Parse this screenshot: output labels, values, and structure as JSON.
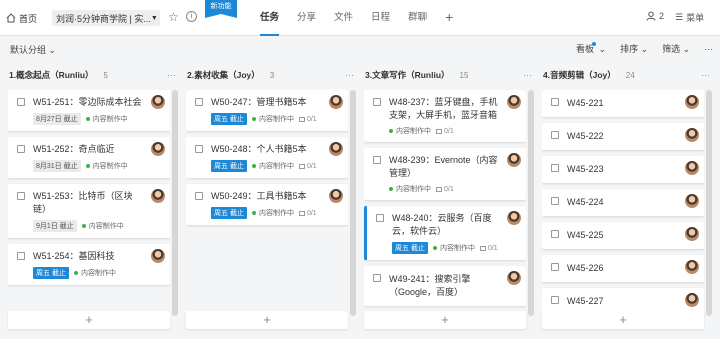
{
  "topbar": {
    "home_label": "首页",
    "project_label": "刘润·5分钟商学院 | 实...",
    "new_feature_badge": "新功能",
    "tabs": [
      "任务",
      "分享",
      "文件",
      "日程",
      "群聊"
    ],
    "active_tab": "任务",
    "members_count": "2",
    "menu_label": "菜单"
  },
  "toolbar": {
    "group_label": "默认分组",
    "board_label": "看板",
    "sort_label": "排序",
    "filter_label": "筛选"
  },
  "columns": [
    {
      "title": "1.概念起点（Runliu）",
      "count": "5",
      "cards": [
        {
          "title": "W51-251：零边际成本社会",
          "due": "8月27日 截止",
          "due_style": "gray",
          "status": "内容制作中"
        },
        {
          "title": "W51-252：奇点临近",
          "due": "8月31日 截止",
          "due_style": "gray",
          "status": "内容制作中"
        },
        {
          "title": "W51-253：比特币（区块链）",
          "due": "9月1日 截止",
          "due_style": "gray",
          "status": "内容制作中"
        },
        {
          "title": "W51-254：基因科技",
          "due": "周五 截止",
          "due_style": "blue",
          "status": "内容制作中"
        }
      ]
    },
    {
      "title": "2.素材收集（Joy）",
      "count": "3",
      "cards": [
        {
          "title": "W50-247：管理书籍5本",
          "due": "周五 截止",
          "due_style": "blue",
          "status": "内容制作中",
          "subtasks": "0/1"
        },
        {
          "title": "W50-248：个人书籍5本",
          "due": "周五 截止",
          "due_style": "blue",
          "status": "内容制作中",
          "subtasks": "0/1"
        },
        {
          "title": "W50-249：工具书籍5本",
          "due": "周五 截止",
          "due_style": "blue",
          "status": "内容制作中",
          "subtasks": "0/1"
        }
      ]
    },
    {
      "title": "3.文章写作（Runliu）",
      "count": "15",
      "cards": [
        {
          "title": "W48-237：蓝牙键盘，手机支架，大屏手机，蓝牙音箱",
          "status": "内容制作中",
          "subtasks": "0/1"
        },
        {
          "title": "W48-239：Evernote（内容管理）",
          "status": "内容制作中",
          "subtasks": "0/1"
        },
        {
          "title": "W48-240：云服务（百度云，软件云）",
          "due": "周五 截止",
          "due_style": "blue",
          "status": "内容制作中",
          "subtasks": "0/1",
          "accent": true
        },
        {
          "title": "W49-241：搜索引擎（Google，百度）"
        }
      ]
    },
    {
      "title": "4.音频剪辑（Joy）",
      "count": "24",
      "cards": [
        {
          "title": "W45-221"
        },
        {
          "title": "W45-222"
        },
        {
          "title": "W45-223"
        },
        {
          "title": "W45-224"
        },
        {
          "title": "W45-225"
        },
        {
          "title": "W45-226"
        },
        {
          "title": "W45-227"
        }
      ]
    }
  ],
  "icons": {
    "home": "home-icon",
    "star": "star-icon",
    "info": "info-icon",
    "add_tab": "plus-icon",
    "members": "user-icon",
    "menu": "menu-icon",
    "more": "more-icon",
    "avatar": "avatar-icon"
  },
  "colors": {
    "accent": "#1e88d8",
    "status_dot": "#3bb34a"
  }
}
